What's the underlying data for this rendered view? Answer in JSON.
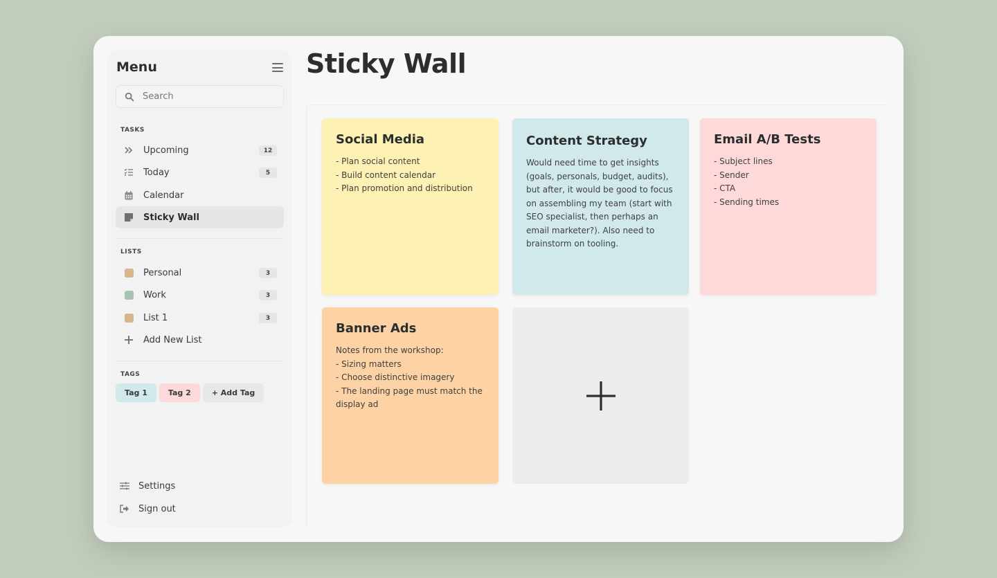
{
  "sidebar": {
    "title": "Menu",
    "search_placeholder": "Search",
    "tasks_label": "TASKS",
    "tasks": [
      {
        "label": "Upcoming",
        "icon": "double-chevron-right-icon",
        "count": "12"
      },
      {
        "label": "Today",
        "icon": "checklist-icon",
        "count": "5"
      },
      {
        "label": "Calendar",
        "icon": "calendar-icon",
        "count": null
      },
      {
        "label": "Sticky Wall",
        "icon": "sticky-note-icon",
        "count": null,
        "active": true
      }
    ],
    "lists_label": "LISTS",
    "lists": [
      {
        "label": "Personal",
        "color": "#d8b48a",
        "count": "3"
      },
      {
        "label": "Work",
        "color": "#a9c2b3",
        "count": "3"
      },
      {
        "label": "List 1",
        "color": "#d8b48a",
        "count": "3"
      }
    ],
    "add_list_label": "Add New List",
    "tags_label": "TAGS",
    "tags": [
      {
        "label": "Tag 1",
        "color": "#d2e9ec"
      },
      {
        "label": "Tag 2",
        "color": "#fdd9d9"
      }
    ],
    "add_tag_label": "+ Add Tag",
    "settings_label": "Settings",
    "signout_label": "Sign out"
  },
  "main": {
    "title": "Sticky Wall",
    "notes": [
      {
        "title": "Social Media",
        "body": "- Plan social content\n- Build content calendar\n- Plan promotion and distribution",
        "color": "#fdf1b3"
      },
      {
        "title": "Content Strategy",
        "body": "Would need time to get insights (goals, personals, budget, audits), but after, it would be good to focus on assembling my team (start with SEO specialist, then perhaps an email marketer?). Also need to brainstorm on tooling.",
        "color": "#d2e9ec"
      },
      {
        "title": "Email A/B Tests",
        "body": "- Subject lines\n- Sender\n- CTA\n- Sending times",
        "color": "#fdd9d9"
      },
      {
        "title": "Banner Ads",
        "body": "Notes from the workshop:\n- Sizing matters\n- Choose distinctive imagery\n- The landing page must match the display ad",
        "color": "#fdd3a6"
      }
    ],
    "add_note_icon": "plus-icon"
  }
}
